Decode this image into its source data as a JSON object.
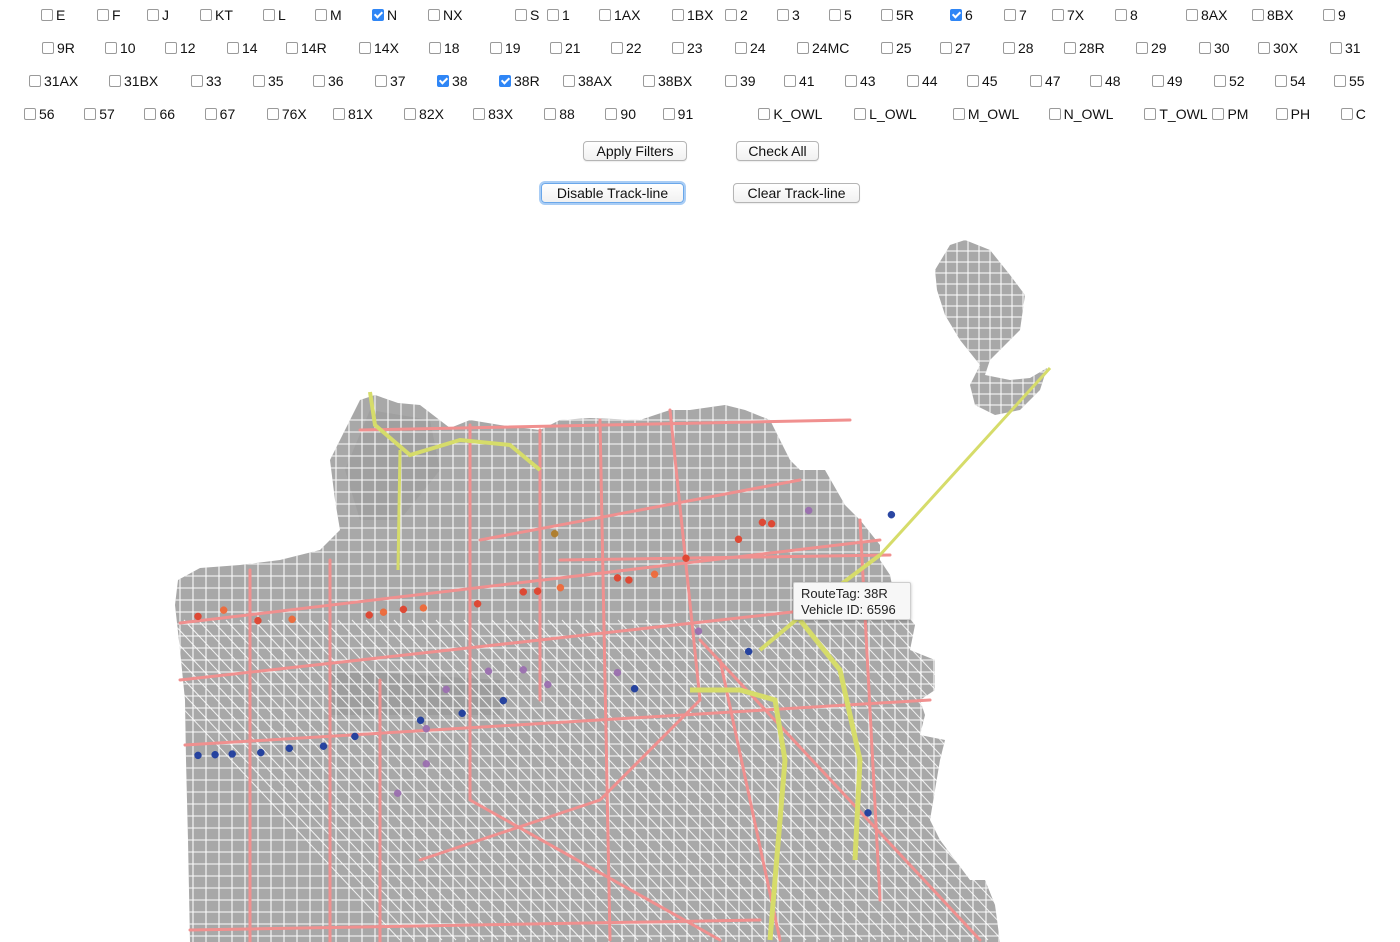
{
  "route_filters": {
    "rows": [
      [
        {
          "label": "E",
          "checked": false
        },
        {
          "label": "F",
          "checked": false
        },
        {
          "label": "J",
          "checked": false
        },
        {
          "label": "KT",
          "checked": false
        },
        {
          "label": "L",
          "checked": false
        },
        {
          "label": "M",
          "checked": false
        },
        {
          "label": "N",
          "checked": true
        },
        {
          "label": "NX",
          "checked": false
        },
        {
          "label": "S",
          "checked": false
        },
        {
          "label": "1",
          "checked": false
        },
        {
          "label": "1AX",
          "checked": false
        },
        {
          "label": "1BX",
          "checked": false
        },
        {
          "label": "2",
          "checked": false
        },
        {
          "label": "3",
          "checked": false
        },
        {
          "label": "5",
          "checked": false
        },
        {
          "label": "5R",
          "checked": false
        },
        {
          "label": "6",
          "checked": true
        },
        {
          "label": "7",
          "checked": false
        },
        {
          "label": "7X",
          "checked": false
        },
        {
          "label": "8",
          "checked": false
        },
        {
          "label": "8AX",
          "checked": false
        },
        {
          "label": "8BX",
          "checked": false
        },
        {
          "label": "9",
          "checked": false
        }
      ],
      [
        {
          "label": "9R",
          "checked": false
        },
        {
          "label": "10",
          "checked": false
        },
        {
          "label": "12",
          "checked": false
        },
        {
          "label": "14",
          "checked": false
        },
        {
          "label": "14R",
          "checked": false
        },
        {
          "label": "14X",
          "checked": false
        },
        {
          "label": "18",
          "checked": false
        },
        {
          "label": "19",
          "checked": false
        },
        {
          "label": "21",
          "checked": false
        },
        {
          "label": "22",
          "checked": false
        },
        {
          "label": "23",
          "checked": false
        },
        {
          "label": "24",
          "checked": false
        },
        {
          "label": "24MC",
          "checked": false
        },
        {
          "label": "25",
          "checked": false
        },
        {
          "label": "27",
          "checked": false
        },
        {
          "label": "28",
          "checked": false
        },
        {
          "label": "28R",
          "checked": false
        },
        {
          "label": "29",
          "checked": false
        },
        {
          "label": "30",
          "checked": false
        },
        {
          "label": "30X",
          "checked": false
        },
        {
          "label": "31",
          "checked": false
        }
      ],
      [
        {
          "label": "31AX",
          "checked": false
        },
        {
          "label": "31BX",
          "checked": false
        },
        {
          "label": "33",
          "checked": false
        },
        {
          "label": "35",
          "checked": false
        },
        {
          "label": "36",
          "checked": false
        },
        {
          "label": "37",
          "checked": false
        },
        {
          "label": "38",
          "checked": true
        },
        {
          "label": "38R",
          "checked": true
        },
        {
          "label": "38AX",
          "checked": false
        },
        {
          "label": "38BX",
          "checked": false
        },
        {
          "label": "39",
          "checked": false
        },
        {
          "label": "41",
          "checked": false
        },
        {
          "label": "43",
          "checked": false
        },
        {
          "label": "44",
          "checked": false
        },
        {
          "label": "45",
          "checked": false
        },
        {
          "label": "47",
          "checked": false
        },
        {
          "label": "48",
          "checked": false
        },
        {
          "label": "49",
          "checked": false
        },
        {
          "label": "52",
          "checked": false
        },
        {
          "label": "54",
          "checked": false
        },
        {
          "label": "55",
          "checked": false
        }
      ],
      [
        {
          "label": "56",
          "checked": false
        },
        {
          "label": "57",
          "checked": false
        },
        {
          "label": "66",
          "checked": false
        },
        {
          "label": "67",
          "checked": false
        },
        {
          "label": "76X",
          "checked": false
        },
        {
          "label": "81X",
          "checked": false
        },
        {
          "label": "82X",
          "checked": false
        },
        {
          "label": "83X",
          "checked": false
        },
        {
          "label": "88",
          "checked": false
        },
        {
          "label": "90",
          "checked": false
        },
        {
          "label": "91",
          "checked": false
        },
        {
          "label": "K_OWL",
          "checked": false
        },
        {
          "label": "L_OWL",
          "checked": false
        },
        {
          "label": "M_OWL",
          "checked": false
        },
        {
          "label": "N_OWL",
          "checked": false
        },
        {
          "label": "T_OWL",
          "checked": false
        },
        {
          "label": "PM",
          "checked": false
        },
        {
          "label": "PH",
          "checked": false
        },
        {
          "label": "C",
          "checked": false
        }
      ]
    ]
  },
  "buttons": {
    "apply_filters": "Apply Filters",
    "check_all": "Check All",
    "disable_trackline": "Disable Track-line",
    "clear_trackline": "Clear Track-line"
  },
  "tooltip": {
    "route_line": "RouteTag: 38R",
    "vehicle_line": "Vehicle ID: 6596"
  },
  "map_style": {
    "land": "#a8a8a8",
    "street": "#ffffff",
    "route_line": "#f0908f",
    "freeway": "#d6dc6a",
    "route_colors": {
      "N": "#1f3d9e",
      "6": "#9b6fb0",
      "38": "#e0442f",
      "38R": "#ef6a3a",
      "other": "#b07d2a"
    }
  },
  "vehicles": [
    {
      "route": "38",
      "lon": -122.5095,
      "lat": 37.78
    },
    {
      "route": "38R",
      "lon": -122.505,
      "lat": 37.7809
    },
    {
      "route": "38",
      "lon": -122.499,
      "lat": 37.7794
    },
    {
      "route": "38R",
      "lon": -122.493,
      "lat": 37.7796
    },
    {
      "route": "38",
      "lon": -122.4795,
      "lat": 37.7802
    },
    {
      "route": "38R",
      "lon": -122.477,
      "lat": 37.7806
    },
    {
      "route": "38",
      "lon": -122.4735,
      "lat": 37.781
    },
    {
      "route": "38R",
      "lon": -122.47,
      "lat": 37.7812
    },
    {
      "route": "38",
      "lon": -122.4605,
      "lat": 37.7818
    },
    {
      "route": "38",
      "lon": -122.4525,
      "lat": 37.7835
    },
    {
      "route": "38",
      "lon": -122.45,
      "lat": 37.7836
    },
    {
      "route": "38R",
      "lon": -122.446,
      "lat": 37.7841
    },
    {
      "route": "38",
      "lon": -122.436,
      "lat": 37.7855
    },
    {
      "route": "38",
      "lon": -122.434,
      "lat": 37.7852
    },
    {
      "route": "38R",
      "lon": -122.4295,
      "lat": 37.786
    },
    {
      "route": "38",
      "lon": -122.424,
      "lat": 37.7883
    },
    {
      "route": "38",
      "lon": -122.4148,
      "lat": 37.791
    },
    {
      "route": "38",
      "lon": -122.4106,
      "lat": 37.7934
    },
    {
      "route": "38",
      "lon": -122.409,
      "lat": 37.7932
    },
    {
      "route": "N",
      "lon": -122.5095,
      "lat": 37.7602
    },
    {
      "route": "N",
      "lon": -122.5065,
      "lat": 37.7603
    },
    {
      "route": "N",
      "lon": -122.5035,
      "lat": 37.7604
    },
    {
      "route": "N",
      "lon": -122.4985,
      "lat": 37.7606
    },
    {
      "route": "N",
      "lon": -122.4935,
      "lat": 37.7612
    },
    {
      "route": "N",
      "lon": -122.4875,
      "lat": 37.7615
    },
    {
      "route": "N",
      "lon": -122.482,
      "lat": 37.7629
    },
    {
      "route": "N",
      "lon": -122.4705,
      "lat": 37.7652
    },
    {
      "route": "N",
      "lon": -122.4632,
      "lat": 37.7662
    },
    {
      "route": "N",
      "lon": -122.456,
      "lat": 37.768
    },
    {
      "route": "N",
      "lon": -122.433,
      "lat": 37.7697
    },
    {
      "route": "N",
      "lon": -122.413,
      "lat": 37.775
    },
    {
      "route": "N",
      "lon": -122.388,
      "lat": 37.7945
    },
    {
      "route": "N",
      "lon": -122.3921,
      "lat": 37.752
    },
    {
      "route": "6",
      "lon": -122.466,
      "lat": 37.7696
    },
    {
      "route": "6",
      "lon": -122.4586,
      "lat": 37.7722
    },
    {
      "route": "6",
      "lon": -122.4525,
      "lat": 37.7724
    },
    {
      "route": "6",
      "lon": -122.4482,
      "lat": 37.7703
    },
    {
      "route": "6",
      "lon": -122.4695,
      "lat": 37.764
    },
    {
      "route": "6",
      "lon": -122.4695,
      "lat": 37.759
    },
    {
      "route": "6",
      "lon": -122.4745,
      "lat": 37.7548
    },
    {
      "route": "6",
      "lon": -122.436,
      "lat": 37.772
    },
    {
      "route": "6",
      "lon": -122.4218,
      "lat": 37.7779
    },
    {
      "route": "6",
      "lon": -122.4025,
      "lat": 37.7951
    },
    {
      "route": "other",
      "lon": -122.447,
      "lat": 37.7918
    }
  ]
}
